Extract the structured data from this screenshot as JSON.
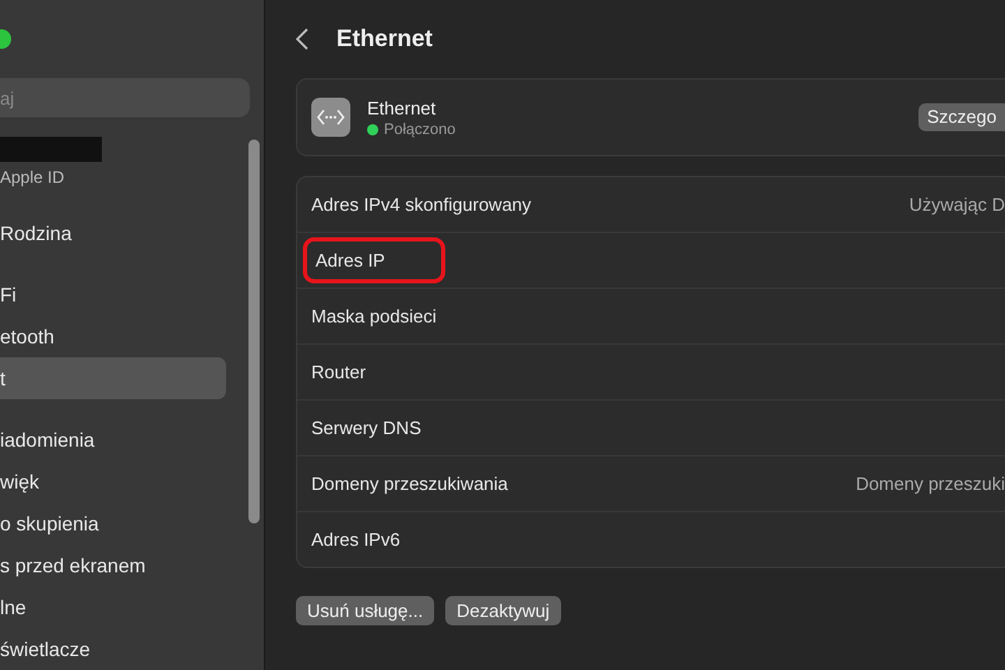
{
  "sidebar": {
    "search": {
      "placeholder": "aj"
    },
    "items": [
      {
        "label": "Apple ID",
        "kind": "account",
        "selected": false
      },
      {
        "label": "Rodzina",
        "kind": "item",
        "selected": false
      },
      {
        "label": "Fi",
        "kind": "item",
        "selected": false
      },
      {
        "label": "etooth",
        "kind": "item",
        "selected": false
      },
      {
        "label": "t",
        "kind": "item",
        "selected": true
      },
      {
        "label": "iadomienia",
        "kind": "item",
        "selected": false
      },
      {
        "label": "więk",
        "kind": "item",
        "selected": false
      },
      {
        "label": "o skupienia",
        "kind": "item",
        "selected": false
      },
      {
        "label": "s przed ekranem",
        "kind": "item",
        "selected": false
      },
      {
        "label": "lne",
        "kind": "item",
        "selected": false
      },
      {
        "label": "świetlacze",
        "kind": "item",
        "selected": false
      }
    ]
  },
  "header": {
    "title": "Ethernet"
  },
  "service": {
    "name": "Ethernet",
    "status": "Połączono",
    "connected": true,
    "details_button": "Szczego"
  },
  "rows": [
    {
      "label": "Adres IPv4 skonfigurowany",
      "value": "Używając D",
      "highlighted": false
    },
    {
      "label": "Adres IP",
      "highlighted": true
    },
    {
      "label": "Maska podsieci",
      "highlighted": false
    },
    {
      "label": "Router",
      "highlighted": false
    },
    {
      "label": "Serwery DNS",
      "highlighted": false
    },
    {
      "label": "Domeny przeszukiwania",
      "value": "Domeny przeszuki",
      "highlighted": false
    },
    {
      "label": "Adres IPv6",
      "highlighted": false
    }
  ],
  "buttons": [
    "Usuń usługę...",
    "Dezaktywuj"
  ]
}
